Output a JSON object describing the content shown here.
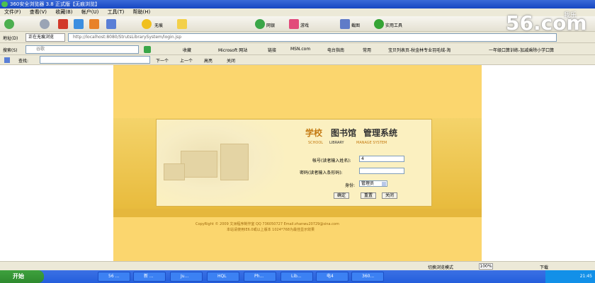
{
  "window": {
    "title": "360安全浏览器 3.8 正式版【无痕浏览】"
  },
  "menu": [
    "文件(F)",
    "查看(V)",
    "收藏(B)",
    "帐户(U)",
    "工具(T)",
    "帮助(H)"
  ],
  "toolbar": {
    "privacy_label": "无痕",
    "mail_label": "网银",
    "game_label": "游戏",
    "screenshot_label": "截图",
    "tools_label": "实用工具"
  },
  "address": {
    "label": "地址(D)",
    "tab_label": "正在无痕浏览",
    "url": "http://localhost:8080/StrutsLibrarySystem/login.jsp"
  },
  "search": {
    "label": "搜索(S)",
    "placeholder": "谷歌"
  },
  "favorites": [
    "收藏",
    "Microsoft 网站",
    "链接",
    "MSN.com",
    "电台指南",
    "常用",
    "宝贝列表页-秋金林专业羽毛绒-淘",
    "一年级口算训练-加减乘除小学口算"
  ],
  "find": {
    "label": "查找:",
    "next": "下一个",
    "prev": "上一个",
    "highlight": "高亮",
    "close": "关闭"
  },
  "page": {
    "title_prefix": "学校",
    "title_logo": "图书馆",
    "title_suffix": "管理系统",
    "subtitle_a": "SCHOOL",
    "subtitle_b": "LIBRARY",
    "subtitle_c": "MANAGE SYSTEM",
    "account_label": "帐号(读者输入姓名):",
    "account_value": "4",
    "password_label": "密码(读者输入条形码):",
    "password_value": "",
    "identity_label": "身份:",
    "identity_value": "管理员",
    "confirm_button": "确定",
    "reset_button": "重置",
    "close_button": "关闭",
    "copyright": "CopyRight © 2009 文洲程序制作室 QQ 736050727 Email:zhanwu20729@sina.com",
    "recommend": "本站请使用IE6.0或以上版本 1024*768为最佳显示效果"
  },
  "status": {
    "mode": "切换浏览模式",
    "zoom": "100%",
    "download": "下载"
  },
  "taskbar": {
    "start": "开始",
    "tasks": [
      "56 ...",
      "新 ...",
      "Ju...",
      "HQL",
      "Ph...",
      "Lib...",
      "电4",
      "360..."
    ],
    "clock": "21:45"
  },
  "watermark": {
    "site": "56.com",
    "tag": "我乐"
  }
}
